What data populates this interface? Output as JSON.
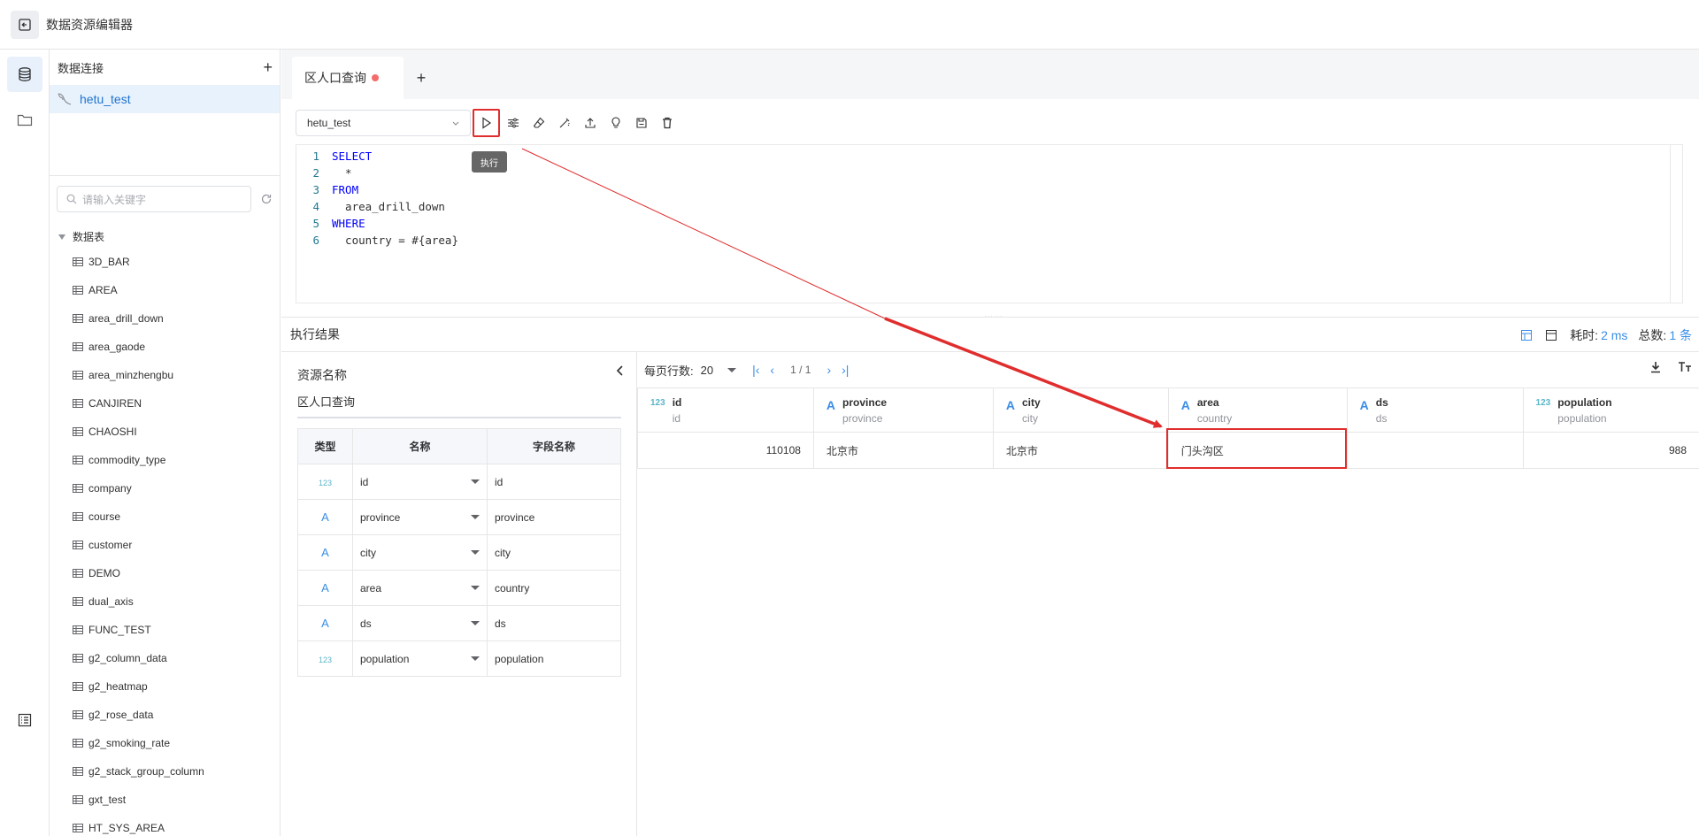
{
  "header": {
    "title": "数据资源编辑器"
  },
  "sidebar": {
    "connections_label": "数据连接",
    "add_label": "+",
    "connection_name": "hetu_test",
    "search_placeholder": "请输入关键字",
    "tree_root_label": "数据表",
    "tables": [
      "3D_BAR",
      "AREA",
      "area_drill_down",
      "area_gaode",
      "area_minzhengbu",
      "CANJIREN",
      "CHAOSHI",
      "commodity_type",
      "company",
      "course",
      "customer",
      "DEMO",
      "dual_axis",
      "FUNC_TEST",
      "g2_column_data",
      "g2_heatmap",
      "g2_rose_data",
      "g2_smoking_rate",
      "g2_stack_group_column",
      "gxt_test",
      "HT_SYS_AREA"
    ]
  },
  "tabs": {
    "active": "区人口查询",
    "add": "+"
  },
  "toolbar": {
    "datasource": "hetu_test",
    "run_tooltip": "执行"
  },
  "editor": {
    "lines": [
      {
        "num": "1",
        "text": "SELECT"
      },
      {
        "num": "2",
        "text": "  *"
      },
      {
        "num": "3",
        "text": "FROM"
      },
      {
        "num": "4",
        "text": "  area_drill_down"
      },
      {
        "num": "5",
        "text": "WHERE"
      },
      {
        "num": "6",
        "text": "  country = #{area}"
      }
    ]
  },
  "result": {
    "title": "执行结果",
    "time_label": "耗时:",
    "time_value": "2 ms",
    "total_label": "总数:",
    "total_value": "1 条"
  },
  "resource": {
    "label": "资源名称",
    "name": "区人口查询",
    "columns": [
      "类型",
      "名称",
      "字段名称"
    ],
    "fields": [
      {
        "type": "123",
        "name": "id",
        "field": "id"
      },
      {
        "type": "A",
        "name": "province",
        "field": "province"
      },
      {
        "type": "A",
        "name": "city",
        "field": "city"
      },
      {
        "type": "A",
        "name": "area",
        "field": "country"
      },
      {
        "type": "A",
        "name": "ds",
        "field": "ds"
      },
      {
        "type": "123",
        "name": "population",
        "field": "population"
      }
    ]
  },
  "grid": {
    "page_size_label": "每页行数:",
    "page_size": "20",
    "page_info": "1 / 1",
    "columns": [
      {
        "type": "123",
        "name": "id",
        "field": "id"
      },
      {
        "type": "A",
        "name": "province",
        "field": "province"
      },
      {
        "type": "A",
        "name": "city",
        "field": "city"
      },
      {
        "type": "A",
        "name": "area",
        "field": "country"
      },
      {
        "type": "A",
        "name": "ds",
        "field": "ds"
      },
      {
        "type": "123",
        "name": "population",
        "field": "population"
      }
    ],
    "rows": [
      {
        "id": "110108",
        "province": "北京市",
        "city": "北京市",
        "area": "门头沟区",
        "ds": "",
        "population": "988"
      }
    ]
  },
  "colors": {
    "accent": "#3a8ee6",
    "highlight": "#e02d2d",
    "unsaved_dot": "#f56c6c"
  }
}
